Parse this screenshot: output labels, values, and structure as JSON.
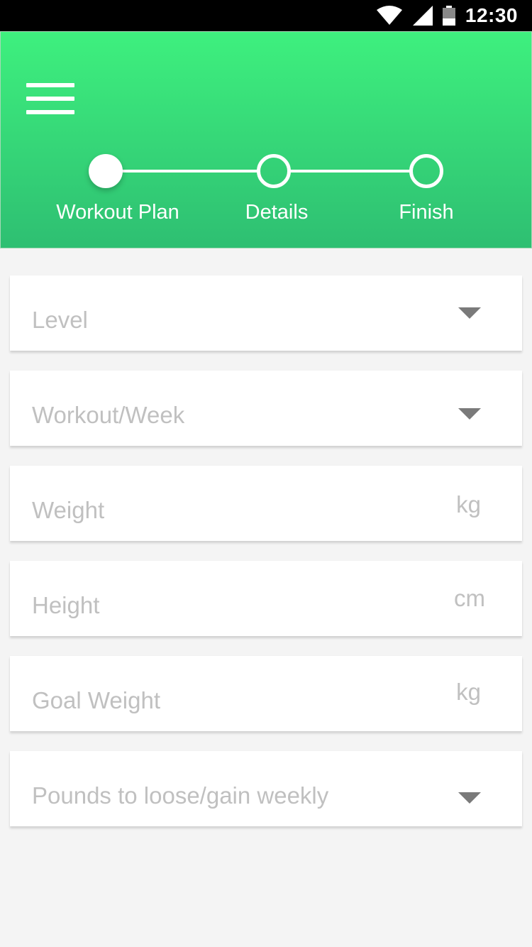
{
  "status_bar": {
    "time": "12:30",
    "icons": [
      "wifi-icon",
      "signal-icon",
      "battery-icon"
    ]
  },
  "header": {
    "menu_icon": "hamburger-menu-icon",
    "steps": [
      {
        "label": "Workout Plan",
        "state": "active"
      },
      {
        "label": "Details",
        "state": "inactive"
      },
      {
        "label": "Finish",
        "state": "inactive"
      }
    ]
  },
  "form": {
    "fields": [
      {
        "placeholder": "Level",
        "type": "dropdown",
        "unit": ""
      },
      {
        "placeholder": "Workout/Week",
        "type": "dropdown",
        "unit": ""
      },
      {
        "placeholder": "Weight",
        "type": "input",
        "unit": "kg"
      },
      {
        "placeholder": "Height",
        "type": "input",
        "unit": "cm"
      },
      {
        "placeholder": "Goal Weight",
        "type": "input",
        "unit": "kg"
      },
      {
        "placeholder": "Pounds to loose/gain weekly",
        "type": "dropdown",
        "unit": ""
      }
    ]
  },
  "colors": {
    "header_top": "#3ef07e",
    "header_bottom": "#2ebf72",
    "placeholder": "#c0c0c0",
    "background": "#f4f4f4"
  }
}
